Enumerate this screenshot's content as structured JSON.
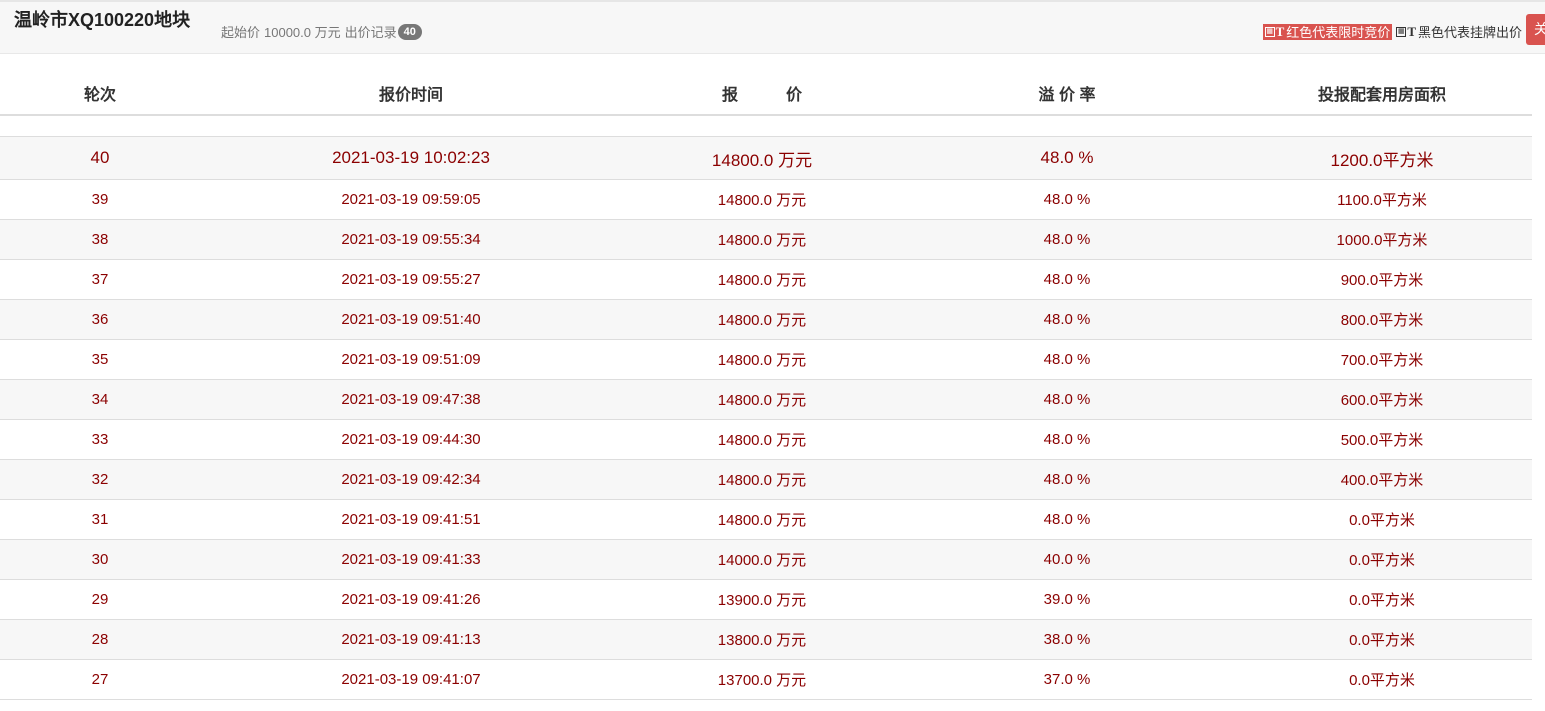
{
  "header": {
    "title": "温岭市XQ100220地块",
    "start_price_label": "起始价",
    "start_price_value": "10000.0 万元",
    "bid_record_label": "出价记录",
    "bid_count": "40",
    "legend_red_text": "红色代表限时竞价",
    "legend_black_text": "黑色代表挂牌出价",
    "close_label": "关"
  },
  "table": {
    "columns": [
      "轮次",
      "报价时间",
      "报　　　价",
      "溢 价 率",
      "投报配套用房面积"
    ],
    "rows": [
      {
        "round": "40",
        "time": "2021-03-19 10:02:23",
        "price": "14800.0 万元",
        "premium": "48.0 %",
        "area": "1200.0平方米"
      },
      {
        "round": "39",
        "time": "2021-03-19 09:59:05",
        "price": "14800.0 万元",
        "premium": "48.0 %",
        "area": "1100.0平方米"
      },
      {
        "round": "38",
        "time": "2021-03-19 09:55:34",
        "price": "14800.0 万元",
        "premium": "48.0 %",
        "area": "1000.0平方米"
      },
      {
        "round": "37",
        "time": "2021-03-19 09:55:27",
        "price": "14800.0 万元",
        "premium": "48.0 %",
        "area": "900.0平方米"
      },
      {
        "round": "36",
        "time": "2021-03-19 09:51:40",
        "price": "14800.0 万元",
        "premium": "48.0 %",
        "area": "800.0平方米"
      },
      {
        "round": "35",
        "time": "2021-03-19 09:51:09",
        "price": "14800.0 万元",
        "premium": "48.0 %",
        "area": "700.0平方米"
      },
      {
        "round": "34",
        "time": "2021-03-19 09:47:38",
        "price": "14800.0 万元",
        "premium": "48.0 %",
        "area": "600.0平方米"
      },
      {
        "round": "33",
        "time": "2021-03-19 09:44:30",
        "price": "14800.0 万元",
        "premium": "48.0 %",
        "area": "500.0平方米"
      },
      {
        "round": "32",
        "time": "2021-03-19 09:42:34",
        "price": "14800.0 万元",
        "premium": "48.0 %",
        "area": "400.0平方米"
      },
      {
        "round": "31",
        "time": "2021-03-19 09:41:51",
        "price": "14800.0 万元",
        "premium": "48.0 %",
        "area": "0.0平方米"
      },
      {
        "round": "30",
        "time": "2021-03-19 09:41:33",
        "price": "14000.0 万元",
        "premium": "40.0 %",
        "area": "0.0平方米"
      },
      {
        "round": "29",
        "time": "2021-03-19 09:41:26",
        "price": "13900.0 万元",
        "premium": "39.0 %",
        "area": "0.0平方米"
      },
      {
        "round": "28",
        "time": "2021-03-19 09:41:13",
        "price": "13800.0 万元",
        "premium": "38.0 %",
        "area": "0.0平方米"
      },
      {
        "round": "27",
        "time": "2021-03-19 09:41:07",
        "price": "13700.0 万元",
        "premium": "37.0 %",
        "area": "0.0平方米"
      }
    ]
  },
  "colors": {
    "bid_text": "#8b0000",
    "legend_red_bg": "#d9534f",
    "badge_bg": "#777777",
    "zebra": "#f7f7f7"
  }
}
